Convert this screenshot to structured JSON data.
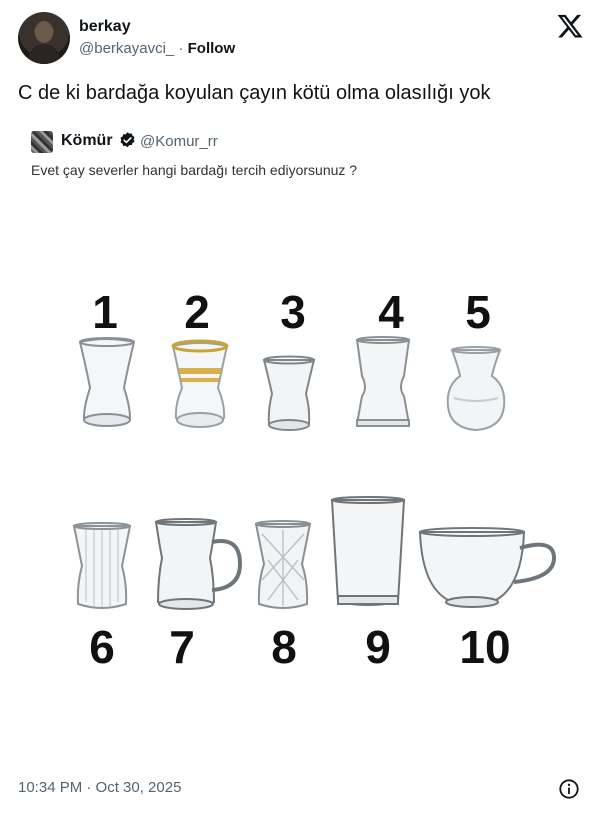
{
  "author": {
    "name": "berkay",
    "handle": "@berkayavci_",
    "separator": "·",
    "follow_label": "Follow"
  },
  "tweet": {
    "text": "C de ki bardağa koyulan çayın kötü olma olasılığı yok"
  },
  "quoted": {
    "name": "Kömür",
    "handle": "@Komur_rr",
    "text": "Evet çay severler hangi bardağı tercih ediyorsunuz ?",
    "image_numbers": [
      "1",
      "2",
      "3",
      "4",
      "5",
      "6",
      "7",
      "8",
      "9",
      "10"
    ]
  },
  "timestamp": "10:34 PM · Oct 30, 2025",
  "icons": {
    "logo": "x-logo-icon",
    "verified": "verified-badge-icon",
    "info": "info-icon"
  },
  "colors": {
    "text": "#0f1419",
    "secondary": "#536471",
    "verified": "#000000"
  }
}
